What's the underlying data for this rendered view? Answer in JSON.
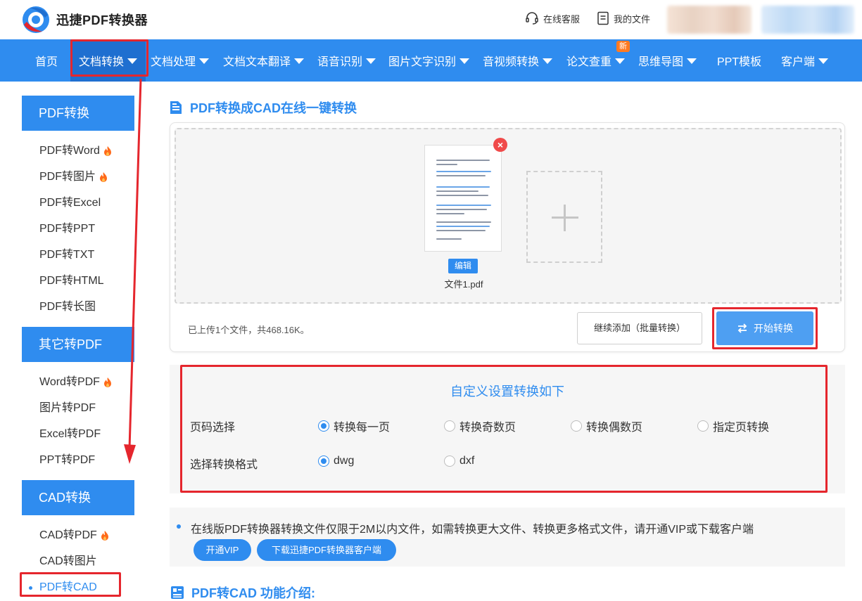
{
  "header": {
    "brand": "迅捷PDF转换器",
    "service_link": "在线客服",
    "files_link": "我的文件"
  },
  "nav": {
    "items": [
      {
        "label": "首页"
      },
      {
        "label": "文档转换"
      },
      {
        "label": "文档处理"
      },
      {
        "label": "文档文本翻译"
      },
      {
        "label": "语音识别"
      },
      {
        "label": "图片文字识别"
      },
      {
        "label": "音视频转换"
      },
      {
        "label": "论文查重"
      },
      {
        "label": "思维导图"
      },
      {
        "label": "PPT模板"
      },
      {
        "label": "客户端"
      }
    ],
    "new_badge": "新"
  },
  "sidebar": {
    "groups": [
      {
        "title": "PDF转换",
        "items": [
          "PDF转Word",
          "PDF转图片",
          "PDF转Excel",
          "PDF转PPT",
          "PDF转TXT",
          "PDF转HTML",
          "PDF转长图"
        ]
      },
      {
        "title": "其它转PDF",
        "items": [
          "Word转PDF",
          "图片转PDF",
          "Excel转PDF",
          "PPT转PDF"
        ]
      },
      {
        "title": "CAD转换",
        "items": [
          "CAD转PDF",
          "CAD转图片",
          "PDF转CAD"
        ]
      }
    ]
  },
  "main": {
    "section_title": "PDF转换成CAD在线一键转换",
    "upload": {
      "edit_label": "编辑",
      "file_name": "文件1.pdf",
      "status": "已上传1个文件，共468.16K。",
      "add_more_label": "继续添加（批量转换）",
      "start_label": "开始转换"
    },
    "settings": {
      "title": "自定义设置转换如下",
      "page_label": "页码选择",
      "page_options": [
        "转换每一页",
        "转换奇数页",
        "转换偶数页",
        "指定页转换"
      ],
      "page_selected": "转换每一页",
      "format_label": "选择转换格式",
      "format_options": [
        "dwg",
        "dxf"
      ],
      "format_selected": "dwg"
    },
    "notice": {
      "text": "在线版PDF转换器转换文件仅限于2M以内文件，如需转换更大文件、转换更多格式文件，请开通VIP或下载客户端",
      "vip_label": "开通VIP",
      "download_label": "下载迅捷PDF转换器客户端"
    },
    "intro_title": "PDF转CAD 功能介绍:"
  },
  "colors": {
    "primary": "#2f8cef",
    "nav_active": "#1f6fd0",
    "annotation_red": "#e5262d",
    "badge": "#ff7a22",
    "flame": "#ff6a1a"
  },
  "icons": [
    "logo-icon",
    "headset-icon",
    "document-icon",
    "flame-icon",
    "close-icon",
    "plus-icon",
    "swap-arrows-icon",
    "list-doc-icon",
    "intro-icon"
  ]
}
